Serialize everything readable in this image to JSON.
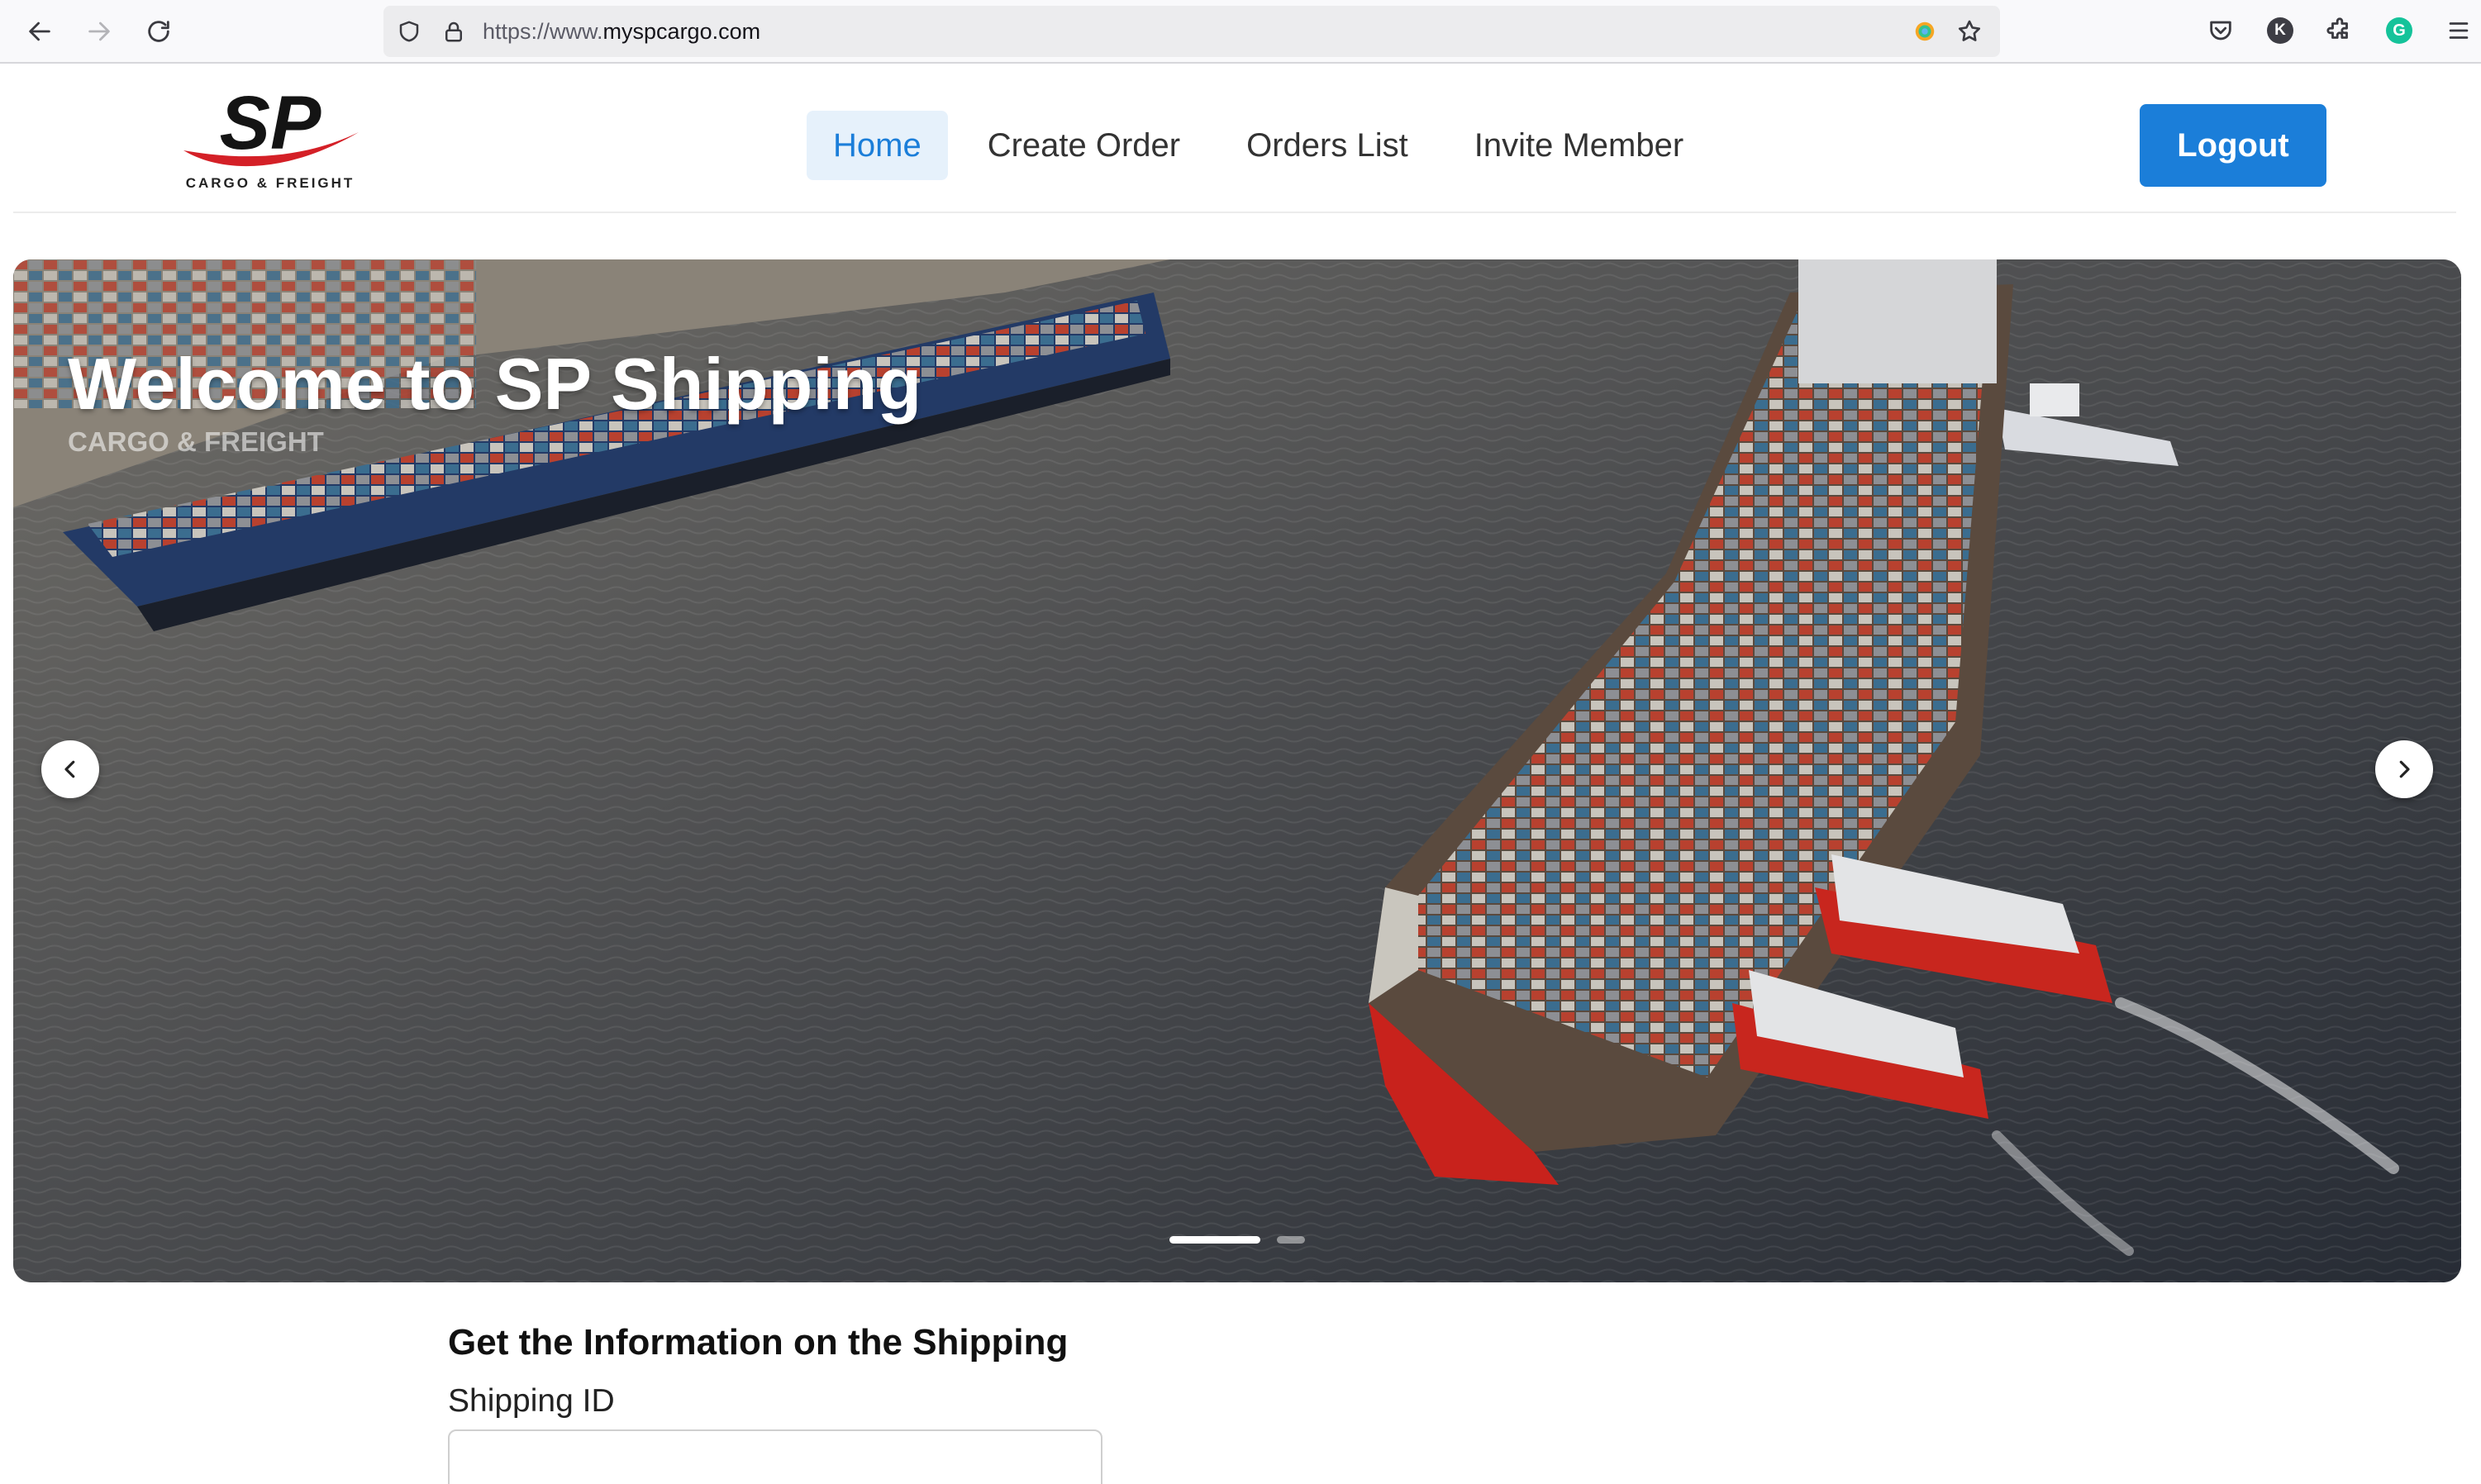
{
  "browser": {
    "url_prefix": "https://www.",
    "url_host": "myspcargo.com",
    "profile_initial": "K",
    "grammarly_initial": "G"
  },
  "header": {
    "logo_mark": "SP",
    "logo_text": "CARGO & FREIGHT",
    "nav": [
      {
        "label": "Home",
        "active": true
      },
      {
        "label": "Create Order",
        "active": false
      },
      {
        "label": "Orders List",
        "active": false
      },
      {
        "label": "Invite Member",
        "active": false
      }
    ],
    "logout_label": "Logout"
  },
  "hero": {
    "title": "Welcome to SP Shipping",
    "subtitle": "CARGO & FREIGHT",
    "slide_count": 2,
    "active_slide": 1
  },
  "shipping": {
    "section_title": "Get the Information on the Shipping",
    "field_label": "Shipping ID",
    "field_value": ""
  },
  "colors": {
    "accent": "#1b7ed9",
    "active_nav_bg": "#e6f1fb",
    "logo_red": "#d42027"
  }
}
